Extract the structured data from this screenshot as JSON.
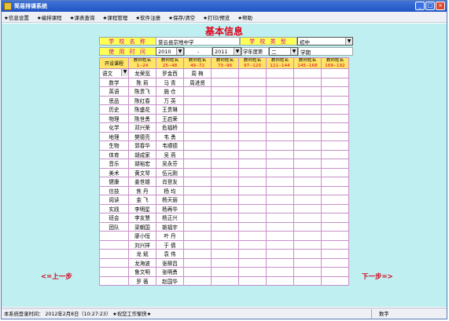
{
  "window": {
    "title": "简易排课系统",
    "buttons": [
      "_",
      "□",
      "×"
    ]
  },
  "menu": [
    "★信息设置",
    "★编排课程",
    "★课表查询",
    "★课程管理",
    "★软件注册",
    "★保存/清空",
    "★打印/预览",
    "★帮助"
  ],
  "page_title": "基本信息",
  "school": {
    "name_label": "学 校 名 称",
    "name_value": "誉云县宗地中学",
    "type_label": "学 校 类 型",
    "type_value": "初中"
  },
  "period": {
    "label": "使 用 时 间",
    "year_from": "2010",
    "dash": "-",
    "year_to": "2011",
    "year_suffix": "学年度第",
    "term": "二",
    "term_suffix": "学期"
  },
  "grid": {
    "course_header": "开设课程",
    "teacher_headers": [
      {
        "top": "教师姓名",
        "bot": "1--24"
      },
      {
        "top": "教师姓名",
        "bot": "25--48"
      },
      {
        "top": "教师姓名",
        "bot": "49--72"
      },
      {
        "top": "教师姓名",
        "bot": "73--96"
      },
      {
        "top": "教师姓名",
        "bot": "97--120"
      },
      {
        "top": "教师姓名",
        "bot": "121--144"
      },
      {
        "top": "教师姓名",
        "bot": "145--168"
      },
      {
        "top": "教师姓名",
        "bot": "169--192"
      }
    ],
    "rows": [
      {
        "course": "语文",
        "teachers": [
          "龙荣宽",
          "罗金西",
          "周  梅",
          "",
          "",
          "",
          "",
          ""
        ]
      },
      {
        "course": "数学",
        "teachers": [
          "陈  莉",
          "马  青",
          "周进贤",
          "",
          "",
          "",
          "",
          ""
        ]
      },
      {
        "course": "英语",
        "teachers": [
          "陈贵飞",
          "施  仓",
          "",
          "",
          "",
          "",
          "",
          ""
        ]
      },
      {
        "course": "思品",
        "teachers": [
          "陈红春",
          "万  英",
          "",
          "",
          "",
          "",
          "",
          ""
        ]
      },
      {
        "course": "历史",
        "teachers": [
          "陈盛花",
          "王贵琳",
          "",
          "",
          "",
          "",
          "",
          ""
        ]
      },
      {
        "course": "物理",
        "teachers": [
          "陈世勇",
          "王启荣",
          "",
          "",
          "",
          "",
          "",
          ""
        ]
      },
      {
        "course": "化学",
        "teachers": [
          "邓兴荣",
          "危福桥",
          "",
          "",
          "",
          "",
          "",
          ""
        ]
      },
      {
        "course": "地理",
        "teachers": [
          "樊德亮",
          "韦  勇",
          "",
          "",
          "",
          "",
          "",
          ""
        ]
      },
      {
        "course": "生物",
        "teachers": [
          "郭春华",
          "韦顺德",
          "",
          "",
          "",
          "",
          "",
          ""
        ]
      },
      {
        "course": "体育",
        "teachers": [
          "胡成家",
          "吴  燕",
          "",
          "",
          "",
          "",
          "",
          ""
        ]
      },
      {
        "course": "音乐",
        "teachers": [
          "胡裕宏",
          "吴永芬",
          "",
          "",
          "",
          "",
          "",
          ""
        ]
      },
      {
        "course": "美术",
        "teachers": [
          "黄文琴",
          "伍元刚",
          "",
          "",
          "",
          "",
          "",
          ""
        ]
      },
      {
        "course": "健康",
        "teachers": [
          "姜世雄",
          "肖登友",
          "",
          "",
          "",
          "",
          "",
          ""
        ]
      },
      {
        "course": "信技",
        "teachers": [
          "焦  丹",
          "杨  均",
          "",
          "",
          "",
          "",
          "",
          ""
        ]
      },
      {
        "course": "阅读",
        "teachers": [
          "金  飞",
          "杨天丽",
          "",
          "",
          "",
          "",
          "",
          ""
        ]
      },
      {
        "course": "实践",
        "teachers": [
          "李明星",
          "杨再华",
          "",
          "",
          "",
          "",
          "",
          ""
        ]
      },
      {
        "course": "班会",
        "teachers": [
          "李友慧",
          "杨正兴",
          "",
          "",
          "",
          "",
          "",
          ""
        ]
      },
      {
        "course": "团队",
        "teachers": [
          "梁朝国",
          "姚福宇",
          "",
          "",
          "",
          "",
          "",
          ""
        ]
      },
      {
        "course": "",
        "teachers": [
          "廖小恒",
          "叶  丹",
          "",
          "",
          "",
          "",
          "",
          ""
        ]
      },
      {
        "course": "",
        "teachers": [
          "刘兴祥",
          "于  倩",
          "",
          "",
          "",
          "",
          "",
          ""
        ]
      },
      {
        "course": "",
        "teachers": [
          "龙  斌",
          "袁  伟",
          "",
          "",
          "",
          "",
          "",
          ""
        ]
      },
      {
        "course": "",
        "teachers": [
          "龙海波",
          "张柳昌",
          "",
          "",
          "",
          "",
          "",
          ""
        ]
      },
      {
        "course": "",
        "teachers": [
          "鲁文明",
          "张明勇",
          "",
          "",
          "",
          "",
          "",
          ""
        ]
      },
      {
        "course": "",
        "teachers": [
          "罗  薇",
          "赵国华",
          "",
          "",
          "",
          "",
          "",
          ""
        ]
      }
    ]
  },
  "nav": {
    "prev": "<=上一步",
    "next": "下一步=>"
  },
  "status": {
    "left": "本系统登录时间： 2012年2月8日（10:27:23） ★祝您工作愉快★",
    "right": "数字"
  },
  "colors": {
    "title_bar": "#2154c3",
    "background": "#bfeff0",
    "label_yellow": "#ffff55",
    "label_magenta": "#cf00ac",
    "accent_red": "#e0001c",
    "grid_border": "#c78fc9"
  }
}
